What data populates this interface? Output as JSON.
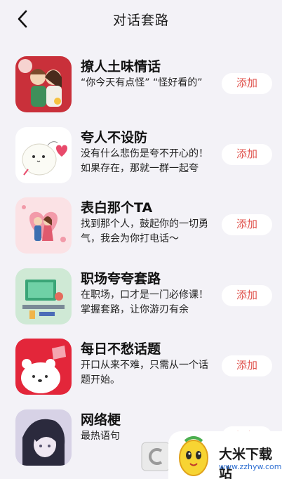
{
  "header": {
    "title": "对话套路",
    "back_icon": "chevron-left-icon"
  },
  "items": [
    {
      "title": "撩人土味情话",
      "desc": "“你今天有点怪” “怪好看的”",
      "add": "添加",
      "thumb": "couple-illustration"
    },
    {
      "title": "夸人不设防",
      "desc": "没有什么悲伤是夸不开心的！如果存在，那就一群一起夸",
      "add": "添加",
      "thumb": "cute-heart-character"
    },
    {
      "title": "表白那个TA",
      "desc": "找到那个人，鼓起你的一切勇气，我会为你打电话～",
      "add": "添加",
      "thumb": "kissing-couple-illustration"
    },
    {
      "title": "职场夸夸套路",
      "desc": "在职场，口才是一门必修课！掌握套路，让你游刃有余",
      "add": "添加",
      "thumb": "office-desk-illustration"
    },
    {
      "title": "每日不愁话题",
      "desc": "开口从来不难，只需从一个话题开始。",
      "add": "添加",
      "thumb": "bear-day-illustration"
    },
    {
      "title": "网络梗",
      "desc": "最热语句",
      "add": "添加",
      "thumb": "anime-character"
    }
  ],
  "watermark": {
    "name": "大米下载站",
    "url": "www.zzhyw.com"
  },
  "colors": {
    "background": "#f3f2f7",
    "accent": "#e0554f"
  }
}
